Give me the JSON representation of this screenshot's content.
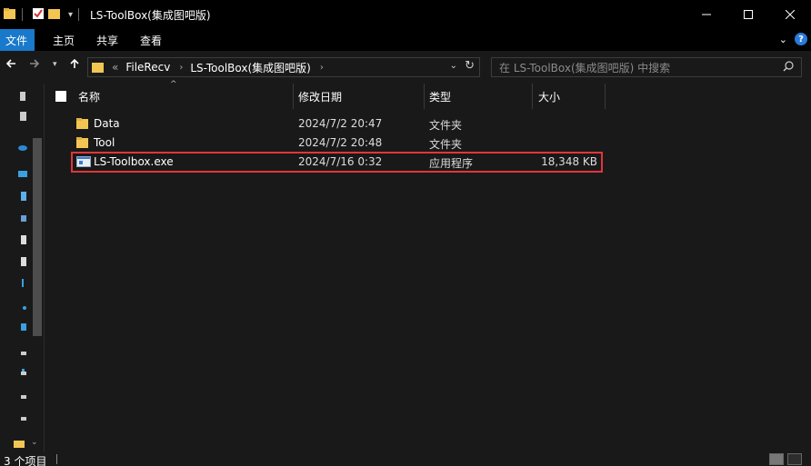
{
  "window": {
    "title": "LS-ToolBox(集成图吧版)",
    "controls": [
      "minimize",
      "maximize",
      "close"
    ]
  },
  "ribbon": {
    "tabs": [
      "文件",
      "主页",
      "共享",
      "查看"
    ]
  },
  "address": {
    "overflow": "«",
    "crumbs": [
      "FileRecv",
      "LS-ToolBox(集成图吧版)"
    ]
  },
  "search": {
    "placeholder": "在 LS-ToolBox(集成图吧版) 中搜索"
  },
  "columns": {
    "name": "名称",
    "date": "修改日期",
    "type": "类型",
    "size": "大小"
  },
  "files": [
    {
      "name": "Data",
      "date": "2024/7/2 20:47",
      "type": "文件夹",
      "size": "",
      "icon": "folder-icon"
    },
    {
      "name": "Tool",
      "date": "2024/7/2 20:48",
      "type": "文件夹",
      "size": "",
      "icon": "folder-icon"
    },
    {
      "name": "LS-Toolbox.exe",
      "date": "2024/7/16 0:32",
      "type": "应用程序",
      "size": "18,348 KB",
      "icon": "exe-icon",
      "highlighted": true
    }
  ],
  "status": {
    "item_count": "3 个项目"
  },
  "colors": {
    "background": "#191919",
    "titlebar": "#000000",
    "file_tab": "#1979ca",
    "highlight_border": "#e0363a",
    "folder": "#f3c653"
  }
}
